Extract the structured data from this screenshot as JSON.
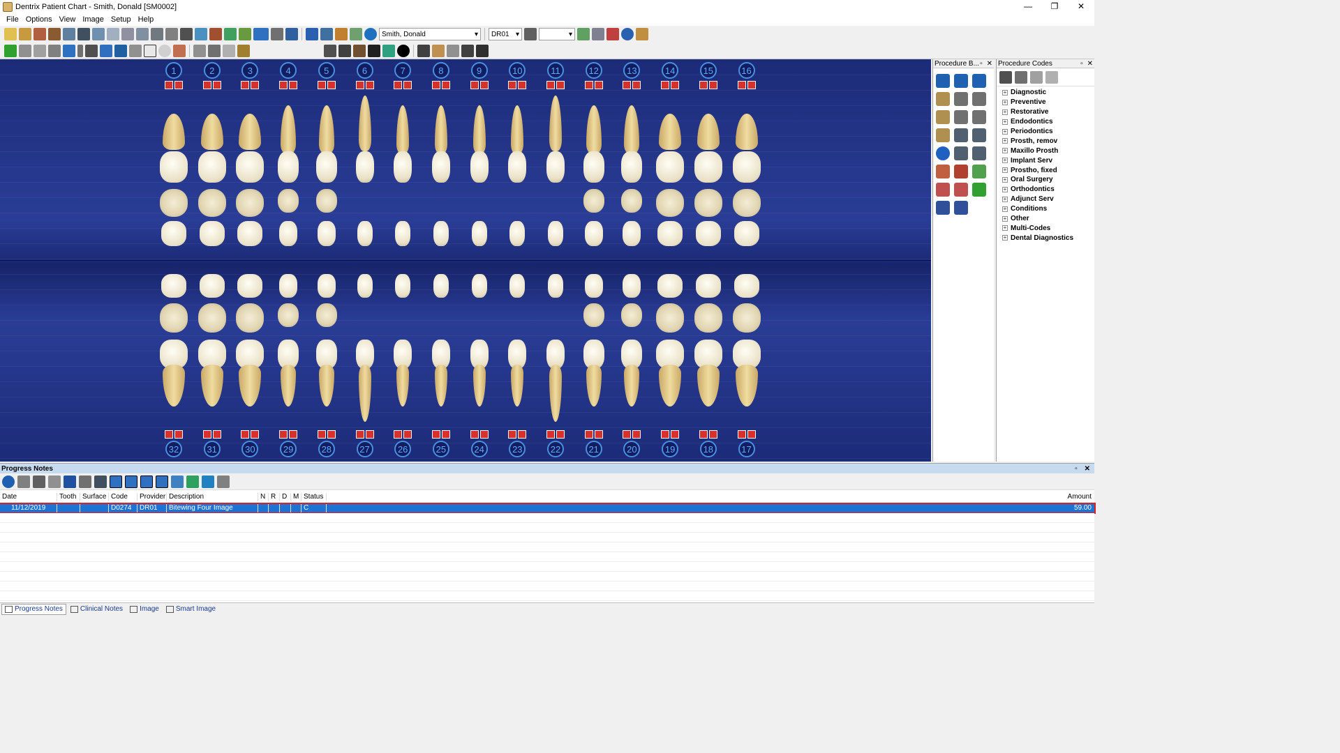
{
  "window": {
    "title": "Dentrix Patient Chart - Smith, Donald [SM0002]",
    "min": "—",
    "max": "❐",
    "close": "✕"
  },
  "menu": [
    "File",
    "Options",
    "View",
    "Image",
    "Setup",
    "Help"
  ],
  "toolbar": {
    "patient_name": "Smith, Donald",
    "provider": "DR01",
    "empty_select": ""
  },
  "chart": {
    "upper_teeth": [
      "1",
      "2",
      "3",
      "4",
      "5",
      "6",
      "7",
      "8",
      "9",
      "10",
      "11",
      "12",
      "13",
      "14",
      "15",
      "16"
    ],
    "lower_teeth": [
      "32",
      "31",
      "30",
      "29",
      "28",
      "27",
      "26",
      "25",
      "24",
      "23",
      "22",
      "21",
      "20",
      "19",
      "18",
      "17"
    ]
  },
  "procedure_buttons": {
    "title": "Procedure B...",
    "pin": "▫",
    "close": "✕"
  },
  "procedure_codes": {
    "title": "Procedure Codes",
    "pin": "▫",
    "close": "✕",
    "categories": [
      "Diagnostic",
      "Preventive",
      "Restorative",
      "Endodontics",
      "Periodontics",
      "Prosth, remov",
      "Maxillo Prosth",
      "Implant Serv",
      "Prostho, fixed",
      "Oral Surgery",
      "Orthodontics",
      "Adjunct Serv",
      "Conditions",
      "Other",
      "Multi-Codes",
      "Dental Diagnostics"
    ]
  },
  "progress_notes": {
    "title": "Progress Notes",
    "pin": "▫",
    "close": "✕",
    "columns": [
      "Date",
      "Tooth",
      "Surface",
      "Code",
      "Provider",
      "Description",
      "N",
      "R",
      "D",
      "M",
      "Status",
      "Amount"
    ],
    "rows": [
      {
        "date": "11/12/2019",
        "tooth": "",
        "surface": "",
        "code": "D0274",
        "provider": "DR01",
        "description": "Bitewing Four Image",
        "n": "",
        "r": "",
        "d": "",
        "m": "",
        "status": "C",
        "amount": "59.00"
      }
    ]
  },
  "bottom_tabs": [
    "Progress Notes",
    "Clinical Notes",
    "Image",
    "Smart Image"
  ],
  "colors": {
    "chart_bg": "#1c2b78",
    "selected_row": "#1e73d2",
    "selected_outline": "#e02020",
    "tooth_number": "#60a8ff"
  }
}
